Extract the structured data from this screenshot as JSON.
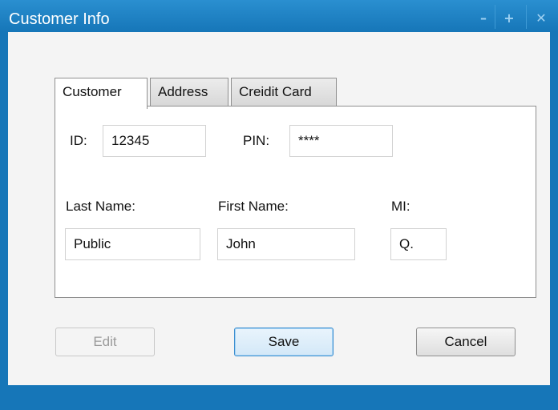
{
  "window": {
    "title": "Customer Info",
    "controls": {
      "minimize": "–",
      "maximize": "+",
      "close": "✕"
    },
    "colors": {
      "frame": "#1676b8",
      "client": "#f4f4f4"
    }
  },
  "tabs": [
    {
      "label": "Customer",
      "active": true
    },
    {
      "label": "Address",
      "active": false
    },
    {
      "label": "Creidit Card",
      "active": false
    }
  ],
  "form": {
    "id_label": "ID:",
    "id_value": "12345",
    "pin_label": "PIN:",
    "pin_value": "****",
    "last_name_label": "Last Name:",
    "last_name_value": "Public",
    "first_name_label": "First Name:",
    "first_name_value": "John",
    "mi_label": "MI:",
    "mi_value": "Q."
  },
  "buttons": {
    "edit": "Edit",
    "save": "Save",
    "cancel": "Cancel"
  }
}
